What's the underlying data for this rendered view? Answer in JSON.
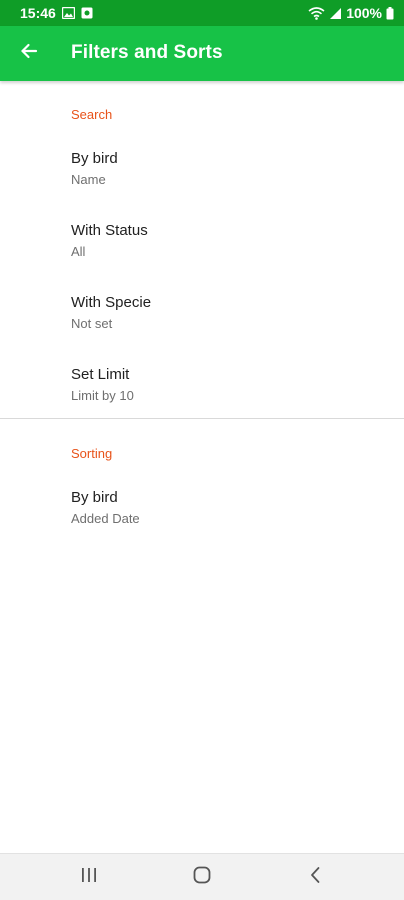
{
  "status_bar": {
    "time": "15:46",
    "battery": "100%"
  },
  "app_bar": {
    "title": "Filters and Sorts"
  },
  "sections": [
    {
      "header": "Search",
      "items": [
        {
          "title": "By bird",
          "summary": "Name"
        },
        {
          "title": "With Status",
          "summary": "All"
        },
        {
          "title": "With Specie",
          "summary": "Not set"
        },
        {
          "title": "Set Limit",
          "summary": "Limit by 10"
        }
      ]
    },
    {
      "header": "Sorting",
      "items": [
        {
          "title": "By bird",
          "summary": "Added Date"
        }
      ]
    }
  ],
  "colors": {
    "status_bar": "#0f9d27",
    "app_bar": "#17c247",
    "category_header": "#e8531a"
  },
  "icons": {
    "back": "arrow-left-icon",
    "recents": "recents-icon",
    "home": "home-icon",
    "nav_back": "nav-back-icon"
  }
}
